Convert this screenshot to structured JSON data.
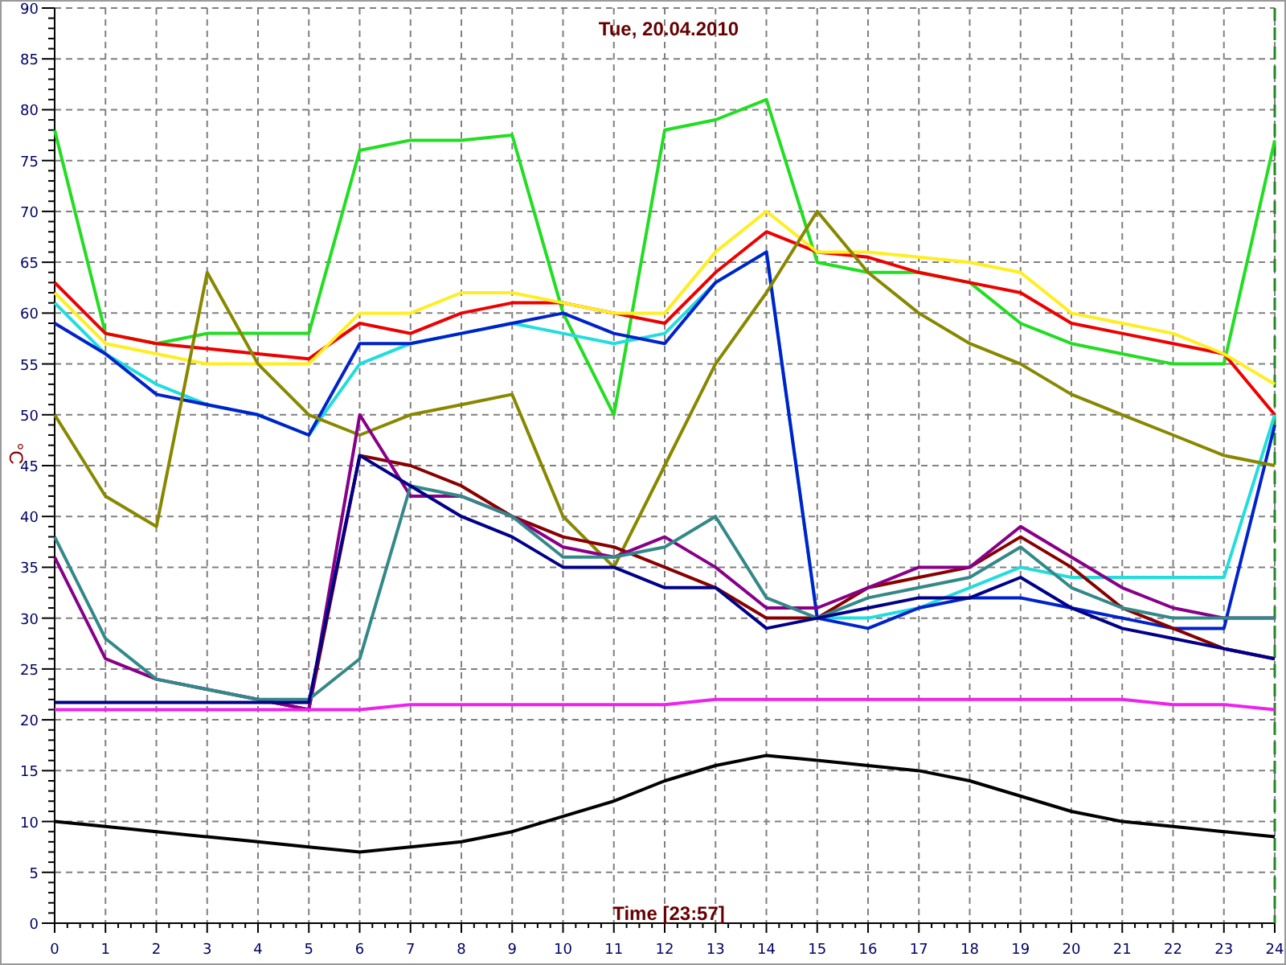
{
  "chart": {
    "chart_data": {
      "type": "line",
      "grid": true,
      "title": "Tue, 20.04.2010",
      "xlabel": "Time [23:57]",
      "ylabel": "°C",
      "x": [
        0,
        1,
        2,
        3,
        4,
        5,
        6,
        7,
        8,
        9,
        10,
        11,
        12,
        13,
        14,
        15,
        16,
        17,
        18,
        19,
        20,
        21,
        22,
        23,
        24
      ],
      "xlim": [
        0,
        24
      ],
      "ylim": [
        0,
        90
      ],
      "xticks": [
        0,
        1,
        2,
        3,
        4,
        5,
        6,
        7,
        8,
        9,
        10,
        11,
        12,
        13,
        14,
        15,
        16,
        17,
        18,
        19,
        20,
        21,
        22,
        23,
        24
      ],
      "yticks": [
        0,
        5,
        10,
        15,
        20,
        25,
        30,
        35,
        40,
        45,
        50,
        55,
        60,
        65,
        70,
        75,
        80,
        85,
        90
      ],
      "series": [
        {
          "color": "#22dd22",
          "values": [
            78,
            58,
            57,
            58,
            58,
            58,
            76,
            77,
            77,
            77.5,
            60,
            50,
            78,
            79,
            81,
            65,
            64,
            64,
            63,
            59,
            57,
            56,
            55,
            55,
            77
          ]
        },
        {
          "color": "#ee0000",
          "values": [
            63,
            58,
            57,
            56.5,
            56,
            55.5,
            59,
            58,
            60,
            61,
            61,
            60,
            59,
            64,
            68,
            66,
            65.5,
            64,
            63,
            62,
            59,
            58,
            57,
            56,
            50
          ]
        },
        {
          "color": "#ffee22",
          "values": [
            62,
            57,
            56,
            55,
            55,
            55,
            60,
            60,
            62,
            62,
            61,
            60,
            60,
            66,
            70,
            66,
            66,
            65.5,
            65,
            64,
            60,
            59,
            58,
            56,
            53
          ]
        },
        {
          "color": "#22dddd",
          "values": [
            61,
            56,
            53,
            51,
            50,
            48,
            55,
            57,
            58,
            59,
            58,
            57,
            58,
            63,
            66,
            30,
            30,
            31,
            33,
            35,
            34,
            34,
            34,
            34,
            50
          ]
        },
        {
          "color": "#0022cc",
          "values": [
            59,
            56,
            52,
            51,
            50,
            48,
            57,
            57,
            58,
            59,
            60,
            58,
            57,
            63,
            66,
            30,
            29,
            31,
            32,
            32,
            31,
            30,
            29,
            29,
            49
          ]
        },
        {
          "color": "#888800",
          "values": [
            50,
            42,
            39,
            64,
            55,
            50,
            48,
            50,
            51,
            52,
            40,
            35,
            45,
            55,
            62,
            70,
            64,
            60,
            57,
            55,
            52,
            50,
            48,
            46,
            45
          ]
        },
        {
          "color": "#880000",
          "values": [
            null,
            null,
            null,
            null,
            22,
            21,
            46,
            45,
            43,
            40,
            38,
            37,
            35,
            33,
            30,
            30,
            33,
            34,
            35,
            38,
            35,
            31,
            29,
            27,
            26
          ]
        },
        {
          "color": "#880088",
          "values": [
            36,
            26,
            24,
            23,
            22,
            21,
            50,
            42,
            42,
            40,
            37,
            36,
            38,
            35,
            31,
            31,
            33,
            35,
            35,
            39,
            36,
            33,
            31,
            30,
            30
          ]
        },
        {
          "color": "#338888",
          "values": [
            38,
            28,
            24,
            23,
            22,
            22,
            26,
            43,
            42,
            40,
            36,
            36,
            37,
            40,
            32,
            30,
            32,
            33,
            34,
            37,
            33,
            31,
            30,
            30,
            30
          ]
        },
        {
          "color": "#000088",
          "values": [
            21.7,
            21.7,
            21.7,
            21.7,
            21.7,
            21.7,
            46,
            43,
            40,
            38,
            35,
            35,
            33,
            33,
            29,
            30,
            31,
            32,
            32,
            34,
            31,
            29,
            28,
            27,
            26
          ]
        },
        {
          "color": "#ee22ee",
          "values": [
            21,
            21,
            21,
            21,
            21,
            21,
            21,
            21.5,
            21.5,
            21.5,
            21.5,
            21.5,
            21.5,
            22,
            22,
            22,
            22,
            22,
            22,
            22,
            22,
            22,
            21.5,
            21.5,
            21
          ]
        },
        {
          "color": "#000000",
          "values": [
            10,
            9.5,
            9,
            8.5,
            8,
            7.5,
            7,
            7.5,
            8,
            9,
            10.5,
            12,
            14,
            15.5,
            16.5,
            16,
            15.5,
            15,
            14,
            12.5,
            11,
            10,
            9.5,
            9,
            8.5
          ]
        }
      ]
    }
  }
}
